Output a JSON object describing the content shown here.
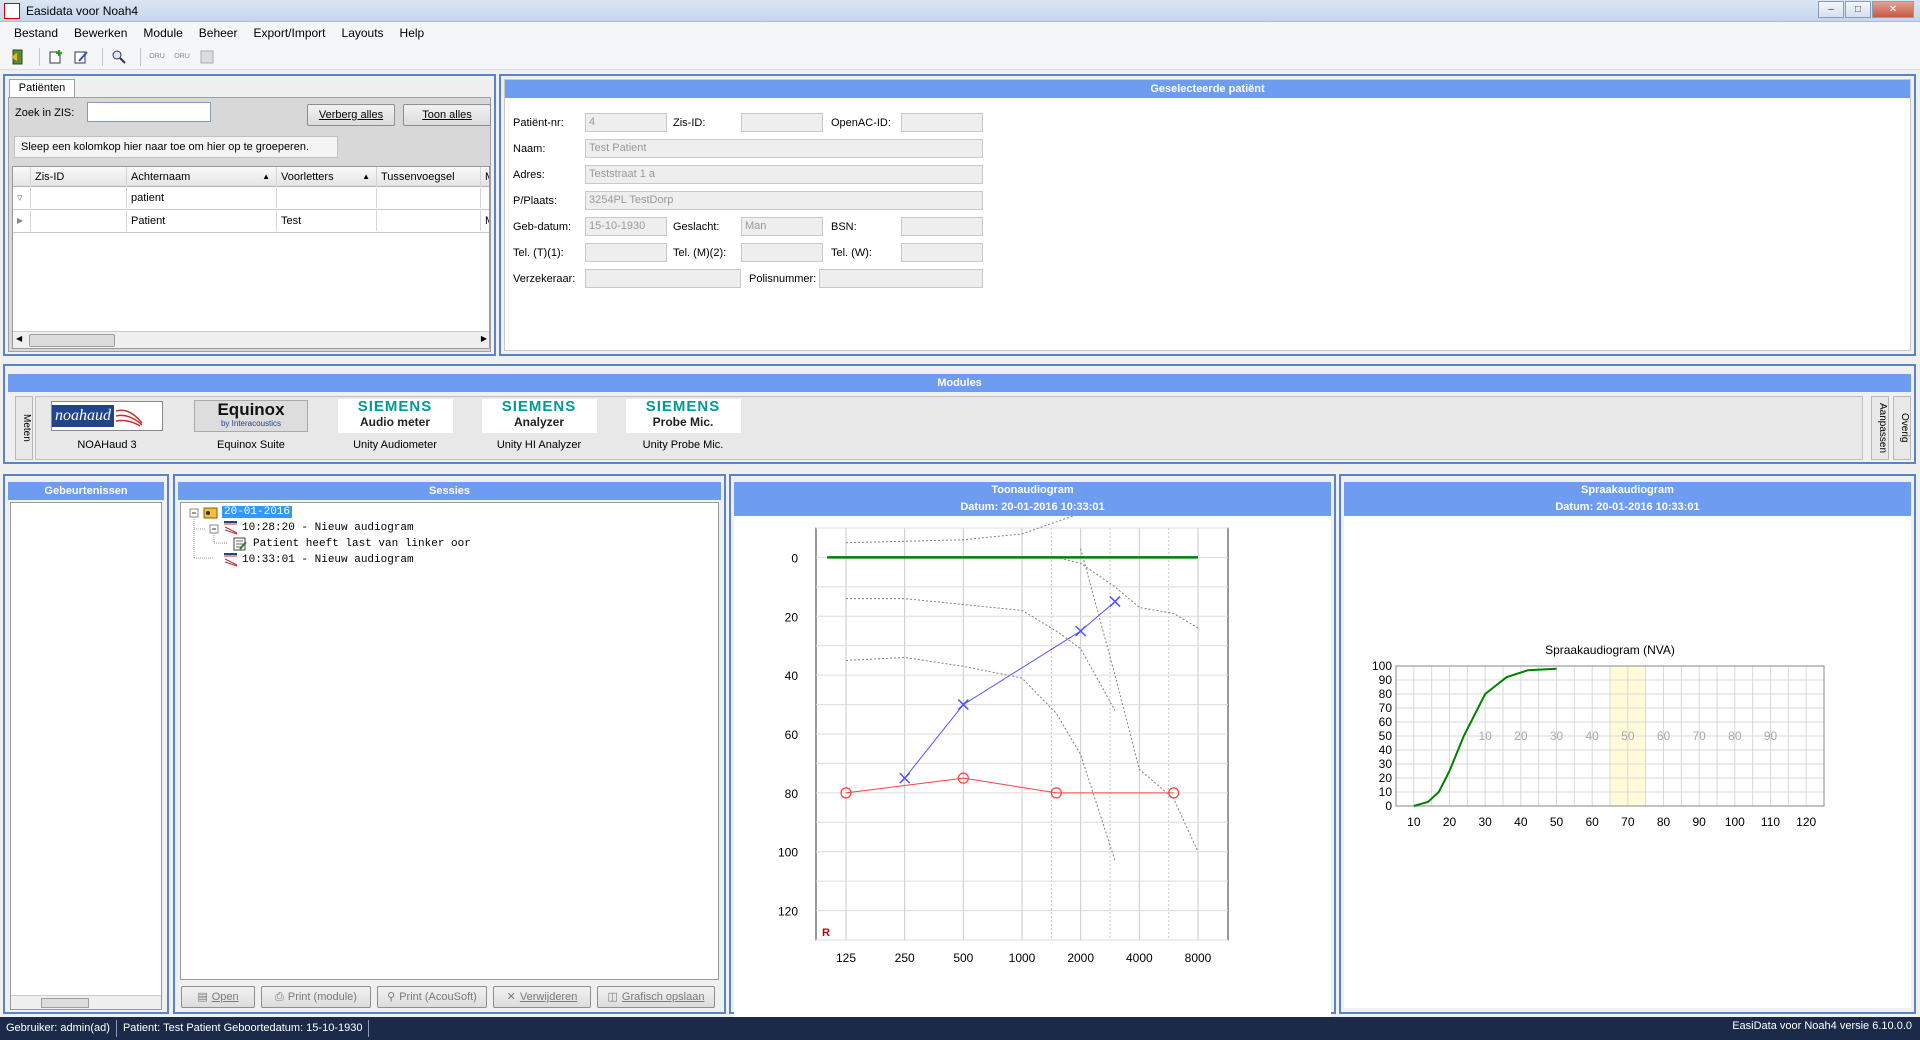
{
  "window": {
    "title": "Easidata voor Noah4",
    "app_icon_text": "Easi Soft"
  },
  "menu": [
    "Bestand",
    "Bewerken",
    "Module",
    "Beheer",
    "Export/Import",
    "Layouts",
    "Help"
  ],
  "toolbar": {
    "icons": [
      "exit-icon",
      "add-patient-icon",
      "edit-patient-icon",
      "search-icon",
      "oru-p-icon",
      "oru-f-icon",
      "oru-grey-icon"
    ],
    "oru_label": "ORU"
  },
  "patients_panel": {
    "tab": "Patiënten",
    "search_label": "Zoek in ZIS:",
    "search_value": "",
    "hide_all": "Verberg alles",
    "show_all": "Toon alles",
    "group_hint": "Sleep een kolomkop hier naar toe om hier op te groeperen.",
    "columns": [
      "Zis-ID",
      "Achternaam",
      "Voorletters",
      "Tussenvoegsel",
      "M"
    ],
    "filter_row": [
      "",
      "patient",
      "",
      "",
      ""
    ],
    "rows": [
      [
        "",
        "Patient",
        "Test",
        "",
        "M"
      ]
    ]
  },
  "selected_patient": {
    "header": "Geselecteerde patiënt",
    "labels": {
      "patient_nr": "Patiënt-nr:",
      "zis_id": "Zis-ID:",
      "openac_id": "OpenAC-ID:",
      "name": "Naam:",
      "address": "Adres:",
      "city": "P/Plaats:",
      "birthdate": "Geb-datum:",
      "gender": "Geslacht:",
      "bsn": "BSN:",
      "tel1": "Tel. (T)(1):",
      "tel2": "Tel. (M)(2):",
      "telw": "Tel. (W):",
      "insurer": "Verzekeraar:",
      "policy": "Polisnummer:"
    },
    "values": {
      "patient_nr": "4",
      "zis_id": "",
      "openac_id": "",
      "name": "Test Patient",
      "address": "Teststraat 1 a",
      "city": "3254PL  TestDorp",
      "birthdate": "15-10-1930",
      "gender": "Man",
      "bsn": "",
      "tel1": "",
      "tel2": "",
      "telw": "",
      "insurer": "",
      "policy": ""
    }
  },
  "modules": {
    "header": "Modules",
    "left_tab": "Meten",
    "right_tabs": [
      "Aanpassen",
      "Overig"
    ],
    "items": [
      {
        "label": "NOAHaud 3",
        "logo": "noahaud"
      },
      {
        "label": "Equinox Suite",
        "logo": "Equinox",
        "logo_sub": "by Interacoustics"
      },
      {
        "label": "Unity Audiometer",
        "logo": "SIEMENS",
        "logo_sub": "Audio meter"
      },
      {
        "label": "Unity HI Analyzer",
        "logo": "SIEMENS",
        "logo_sub": "Analyzer"
      },
      {
        "label": "Unity Probe Mic.",
        "logo": "SIEMENS",
        "logo_sub": "Probe Mic."
      }
    ]
  },
  "events": {
    "header": "Gebeurtenissen"
  },
  "sessions": {
    "header": "Sessies",
    "tree": {
      "date": "20-01-2016",
      "items": [
        {
          "text": "10:28:20 - Nieuw audiogram",
          "child": "Patient heeft last van linker oor"
        },
        {
          "text": "10:33:01 - Nieuw audiogram"
        }
      ]
    },
    "buttons": [
      "Open",
      "Print (module)",
      "Print (AcouSoft)",
      "Verwijderen",
      "Grafisch opslaan"
    ]
  },
  "tone_audiogram": {
    "header": "Toonaudiogram",
    "date": "Datum: 20-01-2016 10:33:01"
  },
  "speech_audiogram": {
    "header": "Spraakaudiogram",
    "date": "Datum: 20-01-2016 10:33:01"
  },
  "chart_data": [
    {
      "type": "line",
      "x": [
        125,
        250,
        500,
        1000,
        2000,
        4000,
        8000
      ],
      "xticks": [
        "125",
        "250",
        "500",
        "1000",
        "2000",
        "4000",
        "8000"
      ],
      "yticks": [
        "0",
        "20",
        "40",
        "60",
        "80",
        "100",
        "120"
      ],
      "ylim": [
        -10,
        130
      ],
      "y_inverted": true,
      "grid": true,
      "marker_label": "R",
      "series": [
        {
          "marker": "x",
          "color": "#5050ff",
          "x": [
            250,
            500,
            2000,
            3000
          ],
          "y": [
            75,
            50,
            25,
            15
          ]
        },
        {
          "marker": "o",
          "color": "#ff4040",
          "x": [
            125,
            500,
            1500,
            6000
          ],
          "y": [
            80,
            75,
            80,
            80
          ]
        },
        {
          "color": "#808080",
          "dashed": true,
          "x": [
            125,
            250,
            500,
            1000,
            2000,
            3000
          ],
          "y": [
            -5,
            -5.5,
            -6,
            -8,
            -15,
            -25
          ]
        },
        {
          "color": "#808080",
          "dashed": true,
          "x": [
            1500,
            2000,
            3000,
            4000,
            6000,
            8000
          ],
          "y": [
            0,
            2,
            10,
            17,
            19,
            24
          ]
        },
        {
          "color": "#808080",
          "dashed": true,
          "x": [
            125,
            250,
            500,
            1000,
            1500,
            2000,
            3000
          ],
          "y": [
            14,
            14,
            16,
            18,
            25,
            31,
            52
          ]
        },
        {
          "color": "#808080",
          "dashed": true,
          "x": [
            2000,
            3000,
            4000,
            6000,
            8000
          ],
          "y": [
            -3,
            40,
            72,
            82,
            100
          ]
        },
        {
          "color": "#808080",
          "dashed": true,
          "x": [
            125,
            250,
            500,
            1000,
            1500,
            2000,
            3000
          ],
          "y": [
            35,
            34,
            37,
            41,
            53,
            67,
            103
          ]
        },
        {
          "color": "#008000",
          "x": [
            100,
            8000
          ],
          "y": [
            0,
            0
          ]
        }
      ]
    },
    {
      "type": "line",
      "title": "Spraakaudiogram (NVA)",
      "xticks": [
        "10",
        "20",
        "30",
        "40",
        "50",
        "60",
        "70",
        "80",
        "90",
        "100",
        "110",
        "120"
      ],
      "yticks": [
        "0",
        "10",
        "20",
        "30",
        "40",
        "50",
        "60",
        "70",
        "80",
        "90",
        "100"
      ],
      "inner_labels": [
        "10",
        "20",
        "30",
        "40",
        "50",
        "60",
        "70",
        "80",
        "90"
      ],
      "xlim": [
        5,
        125
      ],
      "ylim": [
        0,
        100
      ],
      "grid": true,
      "highlight_x": [
        65,
        75
      ],
      "series": [
        {
          "color": "#008000",
          "x": [
            10,
            14,
            17,
            20,
            24,
            30,
            36,
            42,
            50
          ],
          "y": [
            0,
            3,
            10,
            25,
            50,
            80,
            92,
            97,
            98
          ]
        }
      ]
    }
  ],
  "statusbar": {
    "user": "Gebruiker: admin(ad)",
    "patient": "Patient: Test Patient  Geboortedatum: 15-10-1930",
    "version": "EasiData voor Noah4 versie 6.10.0.0"
  }
}
